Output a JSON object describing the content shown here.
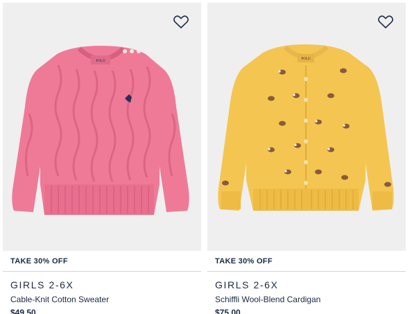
{
  "products": [
    {
      "promo": "TAKE 30% OFF",
      "category": "GIRLS 2-6X",
      "name": "Cable-Knit Cotton Sweater",
      "price": "$49.50",
      "garment_color": "#ef7a97",
      "wishlist_icon": "heart-outline-icon"
    },
    {
      "promo": "TAKE 30% OFF",
      "category": "GIRLS 2-6X",
      "name": "Schiffli Wool-Blend Cardigan",
      "price": "$75.00",
      "garment_color": "#f4c651",
      "wishlist_icon": "heart-outline-icon"
    }
  ],
  "colors": {
    "text_navy": "#1a2a44",
    "image_bg": "#efefef",
    "divider": "#d4d4d4"
  }
}
